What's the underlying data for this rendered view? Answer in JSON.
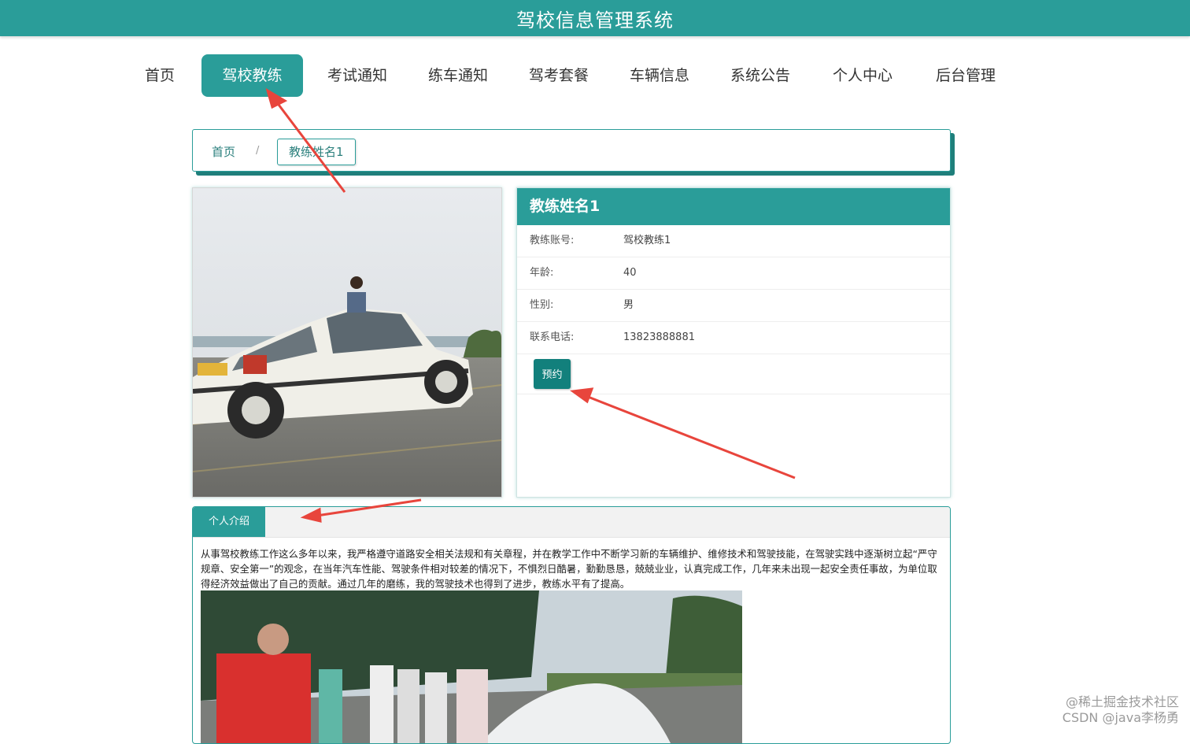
{
  "header": {
    "title": "驾校信息管理系统"
  },
  "nav": {
    "items": [
      {
        "label": "首页",
        "active": false
      },
      {
        "label": "驾校教练",
        "active": true
      },
      {
        "label": "考试通知",
        "active": false
      },
      {
        "label": "练车通知",
        "active": false
      },
      {
        "label": "驾考套餐",
        "active": false
      },
      {
        "label": "车辆信息",
        "active": false
      },
      {
        "label": "系统公告",
        "active": false
      },
      {
        "label": "个人中心",
        "active": false
      },
      {
        "label": "后台管理",
        "active": false
      }
    ]
  },
  "breadcrumb": {
    "home": "首页",
    "separator": "/",
    "current": "教练姓名1"
  },
  "coach": {
    "name": "教练姓名1",
    "fields": [
      {
        "label": "教练账号:",
        "value": "驾校教练1"
      },
      {
        "label": "年龄:",
        "value": "40"
      },
      {
        "label": "性别:",
        "value": "男"
      },
      {
        "label": "联系电话:",
        "value": "13823888881"
      }
    ],
    "book_label": "预约"
  },
  "intro": {
    "tab_label": "个人介绍",
    "text": "从事驾校教练工作这么多年以来，我严格遵守道路安全相关法规和有关章程，并在教学工作中不断学习新的车辆维护、维修技术和驾驶技能，在驾驶实践中逐渐树立起“严守规章、安全第一”的观念，在当年汽车性能、驾驶条件相对较差的情况下，不惧烈日酷暑，勤勤恳恳，兢兢业业，认真完成工作，几年来未出现一起安全责任事故，为单位取得经济效益做出了自己的贡献。通过几年的磨练，我的驾驶技术也得到了进步，教练水平有了提高。"
  },
  "watermark": {
    "line1": "@稀土掘金技术社区",
    "line2": "CSDN @java李杨勇"
  },
  "colors": {
    "primary": "#2a9d99",
    "button": "#12807c",
    "annotation_arrow": "#e8453c"
  }
}
